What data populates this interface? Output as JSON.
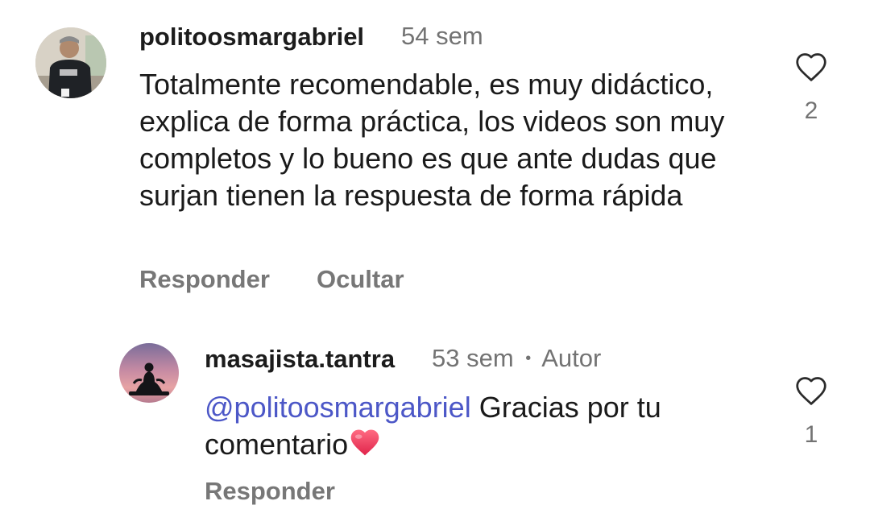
{
  "comments": [
    {
      "username": "politoosmargabriel",
      "time": "54 sem",
      "text": "Totalmente recomendable, es muy didáctico, explica de forma práctica, los videos son muy completos y lo bueno es que ante dudas que surjan tienen la respuesta de forma rápida",
      "likes": "2",
      "actions": {
        "reply": "Responder",
        "hide": "Ocultar"
      }
    }
  ],
  "reply": {
    "username": "masajista.tantra",
    "time": "53 sem",
    "separator": "•",
    "author_badge": "Autor",
    "mention": "@politoosmargabriel",
    "text": " Gracias por tu comentario",
    "emoji": "red-heart",
    "likes": "1",
    "actions": {
      "reply": "Responder"
    }
  },
  "icons": {
    "like": "heart-outline-icon"
  }
}
